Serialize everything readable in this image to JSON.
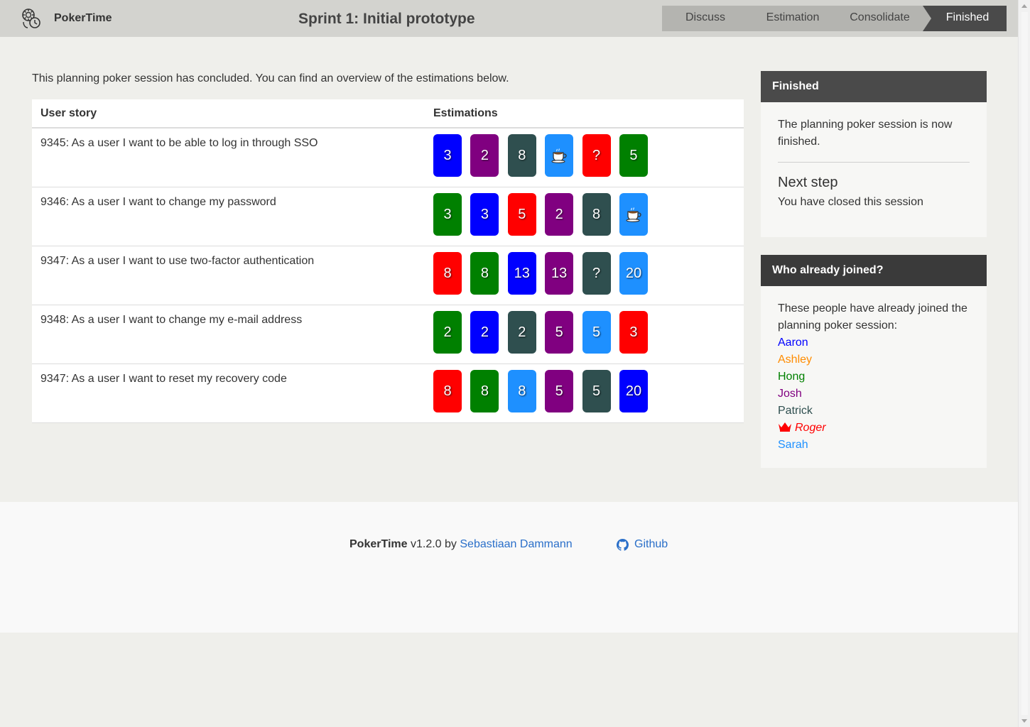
{
  "header": {
    "brand": "PokerTime",
    "session_title": "Sprint 1: Initial prototype",
    "steps": [
      "Discuss",
      "Estimation",
      "Consolidate",
      "Finished"
    ],
    "active_step": "Finished"
  },
  "main": {
    "intro": "This planning poker session has concluded. You can find an overview of the estimations below.",
    "table": {
      "headers": [
        "User story",
        "Estimations"
      ],
      "rows": [
        {
          "story": "9345: As a user I want to be able to log in through SSO",
          "cards": [
            {
              "value": "3",
              "color": "#0000ff"
            },
            {
              "value": "2",
              "color": "#800080"
            },
            {
              "value": "8",
              "color": "#2f4f4f"
            },
            {
              "value": "coffee",
              "color": "#1e90ff"
            },
            {
              "value": "?",
              "color": "#ff0000"
            },
            {
              "value": "5",
              "color": "#008000"
            }
          ]
        },
        {
          "story": "9346: As a user I want to change my password",
          "cards": [
            {
              "value": "3",
              "color": "#008000"
            },
            {
              "value": "3",
              "color": "#0000ff"
            },
            {
              "value": "5",
              "color": "#ff0000"
            },
            {
              "value": "2",
              "color": "#800080"
            },
            {
              "value": "8",
              "color": "#2f4f4f"
            },
            {
              "value": "coffee",
              "color": "#1e90ff"
            }
          ]
        },
        {
          "story": "9347: As a user I want to use two-factor authentication",
          "cards": [
            {
              "value": "8",
              "color": "#ff0000"
            },
            {
              "value": "8",
              "color": "#008000"
            },
            {
              "value": "13",
              "color": "#0000ff"
            },
            {
              "value": "13",
              "color": "#800080"
            },
            {
              "value": "?",
              "color": "#2f4f4f"
            },
            {
              "value": "20",
              "color": "#1e90ff"
            }
          ]
        },
        {
          "story": "9348: As a user I want to change my e-mail address",
          "cards": [
            {
              "value": "2",
              "color": "#008000"
            },
            {
              "value": "2",
              "color": "#0000ff"
            },
            {
              "value": "2",
              "color": "#2f4f4f"
            },
            {
              "value": "5",
              "color": "#800080"
            },
            {
              "value": "5",
              "color": "#1e90ff"
            },
            {
              "value": "3",
              "color": "#ff0000"
            }
          ]
        },
        {
          "story": "9347: As a user I want to reset my recovery code",
          "cards": [
            {
              "value": "8",
              "color": "#ff0000"
            },
            {
              "value": "8",
              "color": "#008000"
            },
            {
              "value": "8",
              "color": "#1e90ff"
            },
            {
              "value": "5",
              "color": "#800080"
            },
            {
              "value": "5",
              "color": "#2f4f4f"
            },
            {
              "value": "20",
              "color": "#0000ff"
            }
          ]
        }
      ]
    }
  },
  "sidebar": {
    "finished_panel": {
      "title": "Finished",
      "text": "The planning poker session is now finished.",
      "next_step_title": "Next step",
      "next_step_text": "You have closed this session"
    },
    "joined_panel": {
      "title": "Who already joined?",
      "text": "These people have already joined the planning poker session:",
      "people": [
        {
          "name": "Aaron",
          "color": "#0000ff",
          "host": false
        },
        {
          "name": "Ashley",
          "color": "#ff8c00",
          "host": false
        },
        {
          "name": "Hong",
          "color": "#008000",
          "host": false
        },
        {
          "name": "Josh",
          "color": "#800080",
          "host": false
        },
        {
          "name": "Patrick",
          "color": "#2f4f4f",
          "host": false
        },
        {
          "name": "Roger",
          "color": "#ff0000",
          "host": true
        },
        {
          "name": "Sarah",
          "color": "#1e90ff",
          "host": false
        }
      ]
    }
  },
  "footer": {
    "app_name": "PokerTime",
    "version_by": "v1.2.0 by",
    "author": "Sebastiaan Dammann",
    "github_label": "Github"
  },
  "icons": {
    "brand": "poker-chip-clock-icon",
    "host": "crown-icon",
    "coffee": "coffee-cup-icon",
    "github": "github-icon"
  }
}
